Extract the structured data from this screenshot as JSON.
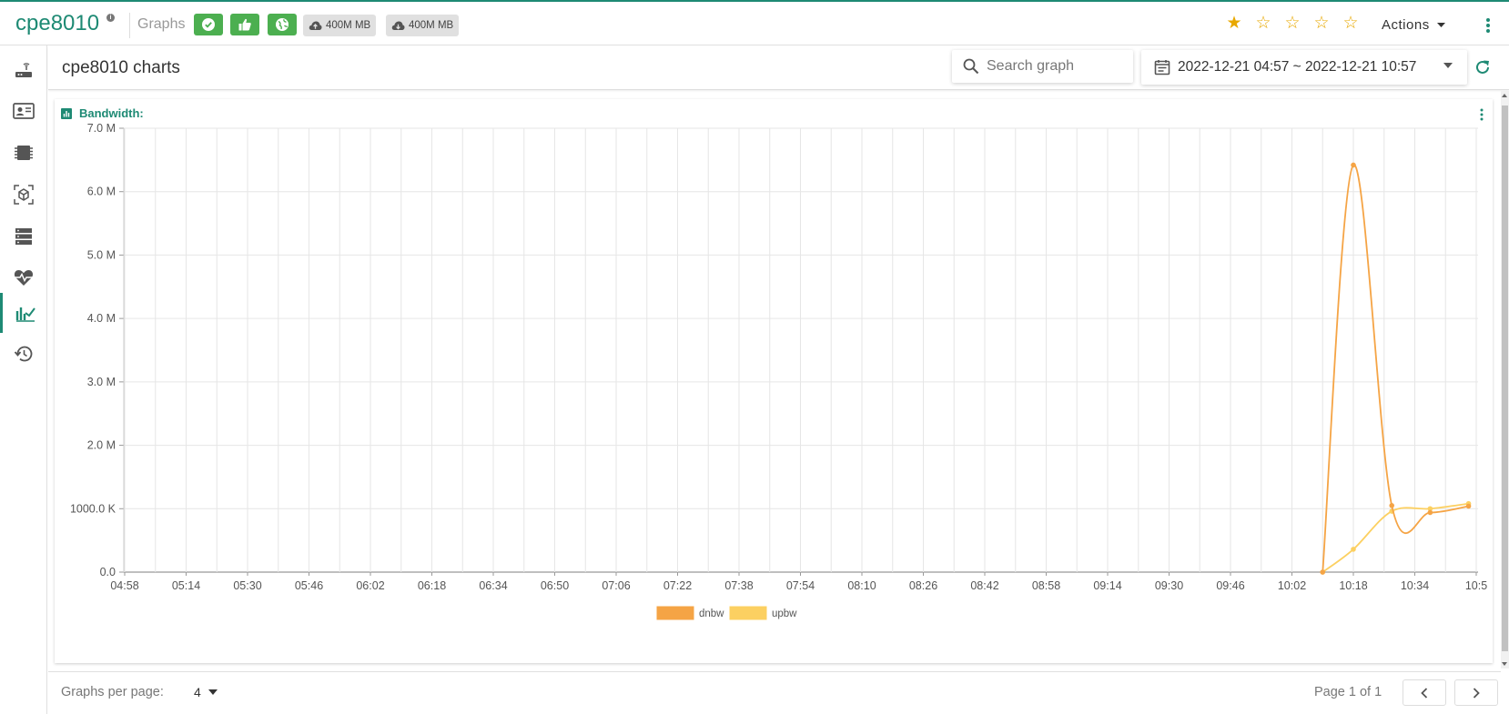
{
  "topbar": {
    "device_name": "cpe8010",
    "graphs_label": "Graphs",
    "upload_chip": "400M MB",
    "download_chip": "400M MB",
    "rating_stars": 1,
    "actions_label": "Actions"
  },
  "sidebar": {
    "items": [
      "router-icon",
      "contact-card-icon",
      "chip-icon",
      "package-icon",
      "server-icon",
      "heartbeat-icon",
      "chart-icon",
      "history-icon"
    ],
    "active": "chart-icon"
  },
  "main": {
    "title": "cpe8010 charts",
    "search_placeholder": "Search graph",
    "date_range": "2022-12-21 04:57 ~ 2022-12-21 10:57"
  },
  "panel": {
    "title": "Bandwidth:"
  },
  "chart_data": {
    "type": "line",
    "title": "Bandwidth:",
    "x_ticks": [
      "04:58",
      "05:14",
      "05:30",
      "05:46",
      "06:02",
      "06:18",
      "06:34",
      "06:50",
      "07:06",
      "07:22",
      "07:38",
      "07:54",
      "08:10",
      "08:26",
      "08:42",
      "08:58",
      "09:14",
      "09:30",
      "09:46",
      "10:02",
      "10:18",
      "10:34",
      "10:5"
    ],
    "y_ticks": [
      "0.0",
      "1000.0 K",
      "2.0 M",
      "3.0 M",
      "4.0 M",
      "5.0 M",
      "6.0 M",
      "7.0 M"
    ],
    "ylim": [
      0,
      7000000
    ],
    "legend_position": "bottom-center",
    "grid": true,
    "series": [
      {
        "name": "dnbw",
        "color": "#f5a445",
        "points": [
          [
            "10:10",
            0
          ],
          [
            "10:18",
            6420000
          ],
          [
            "10:28",
            1050000
          ],
          [
            "10:38",
            940000
          ],
          [
            "10:48",
            1040000
          ]
        ]
      },
      {
        "name": "upbw",
        "color": "#fcd061",
        "points": [
          [
            "10:10",
            0
          ],
          [
            "10:18",
            360000
          ],
          [
            "10:28",
            960000
          ],
          [
            "10:38",
            1000000
          ],
          [
            "10:48",
            1080000
          ]
        ]
      }
    ]
  },
  "footer": {
    "per_page_label": "Graphs per page:",
    "per_page_value": "4",
    "page_info": "Page 1 of 1"
  },
  "colors": {
    "accent": "#1e8a74",
    "status_green": "#4caf50",
    "star": "#e8a800"
  }
}
